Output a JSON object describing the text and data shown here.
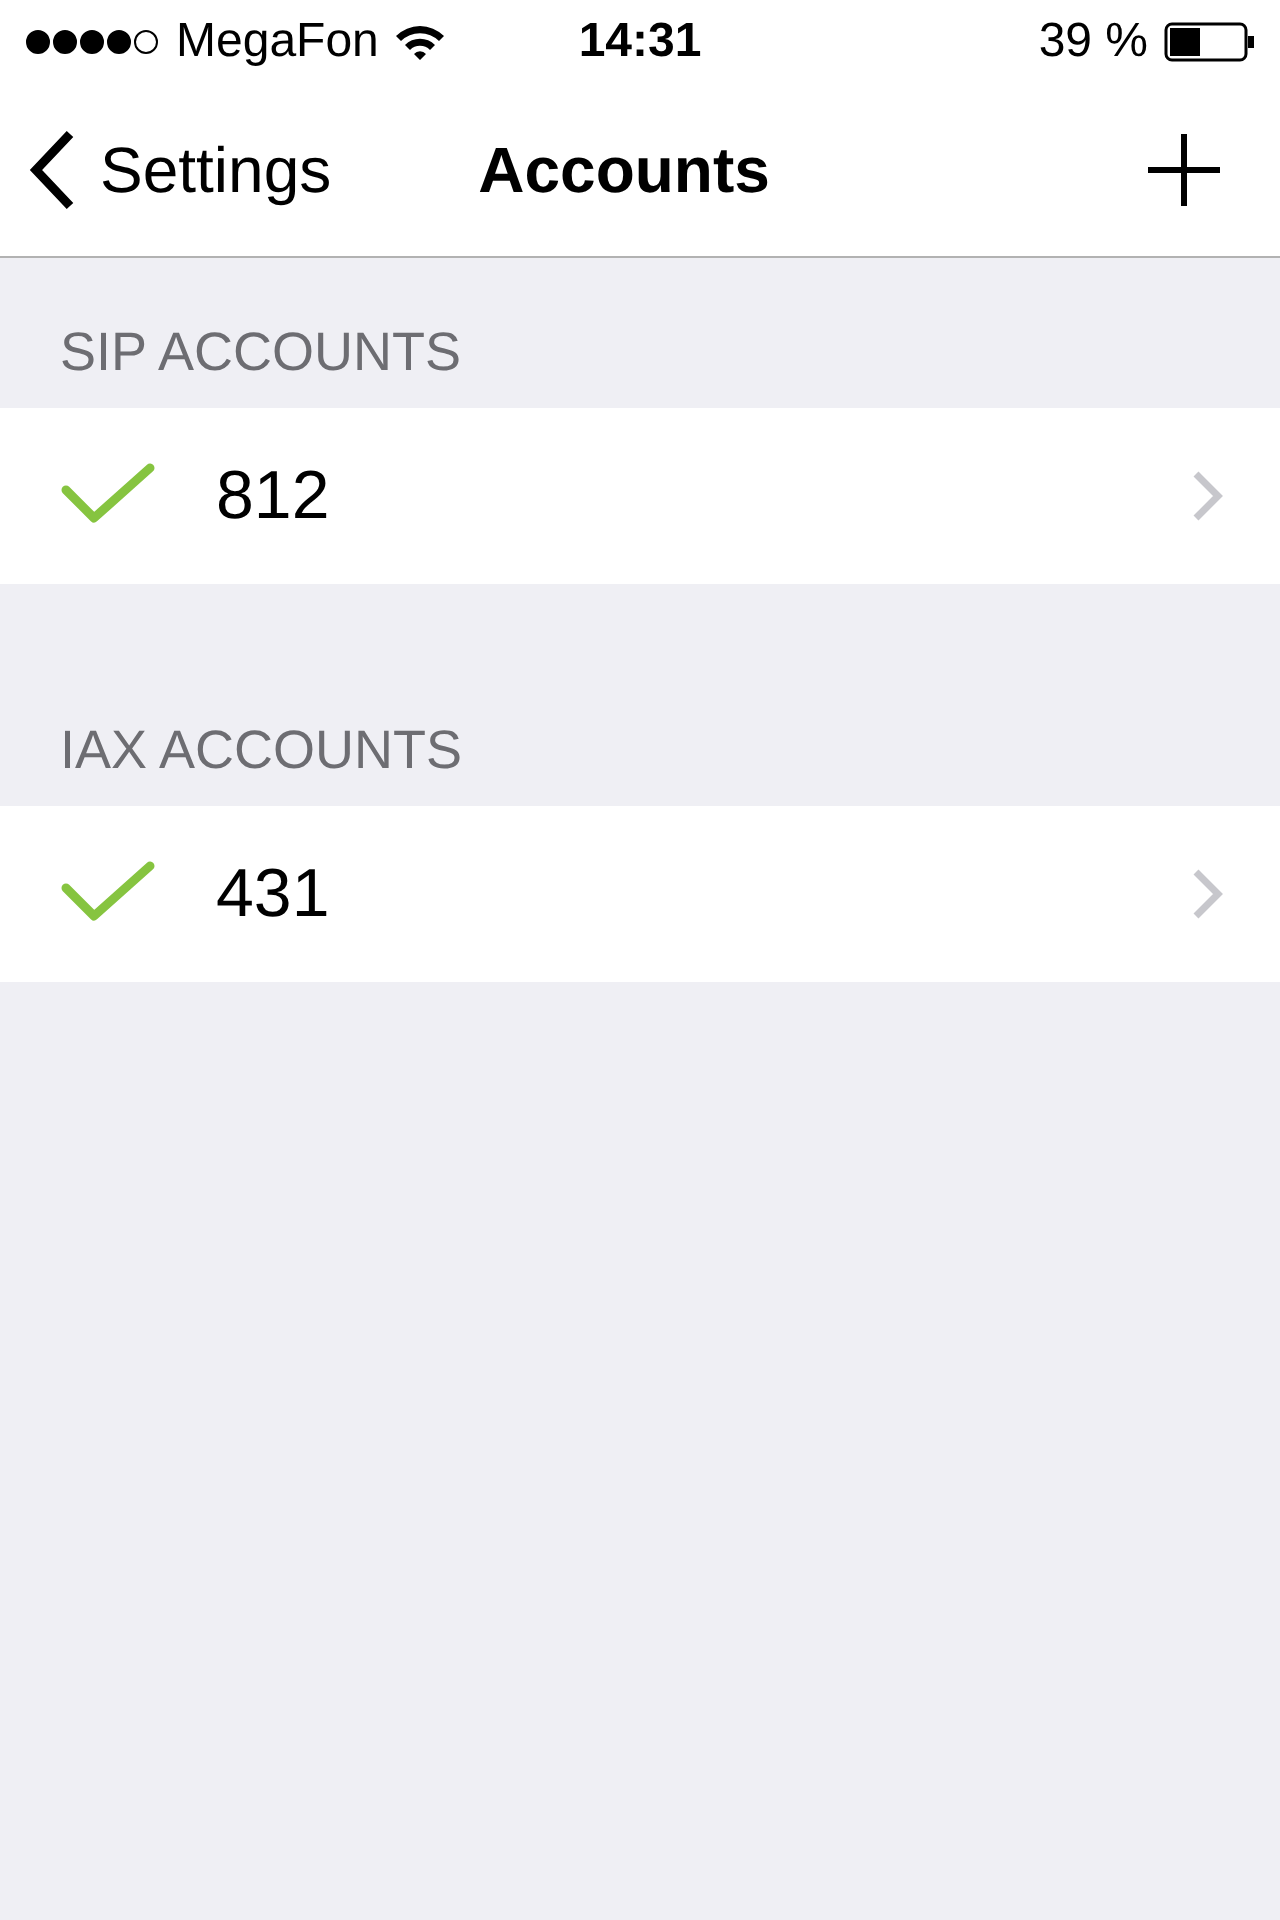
{
  "status_bar": {
    "carrier": "MegaFon",
    "time": "14:31",
    "battery": "39 %"
  },
  "nav": {
    "back": "Settings",
    "title": "Accounts"
  },
  "sections": [
    {
      "header": "SIP ACCOUNTS",
      "rows": [
        {
          "label": "812",
          "enabled": true
        }
      ]
    },
    {
      "header": "IAX ACCOUNTS",
      "rows": [
        {
          "label": "431",
          "enabled": true
        }
      ]
    }
  ]
}
